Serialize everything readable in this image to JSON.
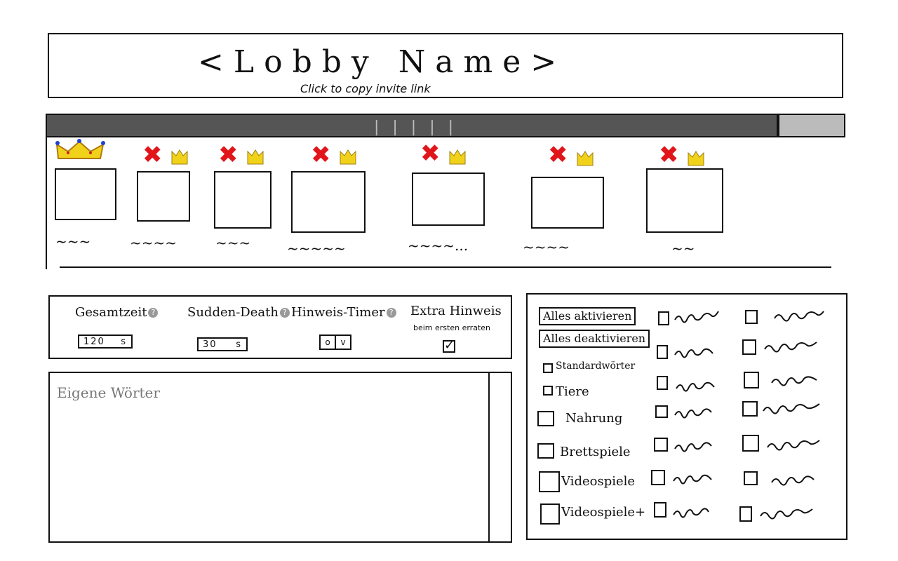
{
  "header": {
    "lobby_name": "<Lobby Name>",
    "invite_hint": "Click to copy invite link"
  },
  "players": {
    "bar_handle": "| | | | |",
    "list": [
      {
        "name": "~~~",
        "is_host": true
      },
      {
        "name": "~~~~",
        "is_host": false
      },
      {
        "name": "~~~",
        "is_host": false
      },
      {
        "name": "~~~~~",
        "is_host": false
      },
      {
        "name": "~~~~...",
        "is_host": false
      },
      {
        "name": "~~~~",
        "is_host": false
      },
      {
        "name": "~~",
        "is_host": false
      }
    ],
    "kick_symbol": "✖"
  },
  "settings": {
    "total_time_label": "Gesamtzeit",
    "total_time_value": "120",
    "total_time_unit": "s",
    "sudden_death_label": "Sudden-Death",
    "sudden_death_value": "30",
    "sudden_death_unit": "s",
    "hint_timer_label": "Hinweis-Timer",
    "hint_timer_off": "o",
    "hint_timer_on": "v",
    "extra_hint_label": "Extra Hinweis",
    "extra_hint_sub": "beim ersten erraten",
    "extra_hint_checked": true,
    "help_symbol": "?"
  },
  "custom_words": {
    "placeholder": "Eigene Wörter"
  },
  "categories": {
    "activate_all": "Alles aktivieren",
    "deactivate_all": "Alles deaktivieren",
    "named": [
      "Standardwörter",
      "Tiere",
      "Nahrung",
      "Brettspiele",
      "Videospiele",
      "Videospiele+"
    ]
  },
  "colors": {
    "bar": "#555555",
    "bar_right": "#bbbbbb",
    "kick": "#e0161b",
    "crown": "#f1d21a"
  }
}
